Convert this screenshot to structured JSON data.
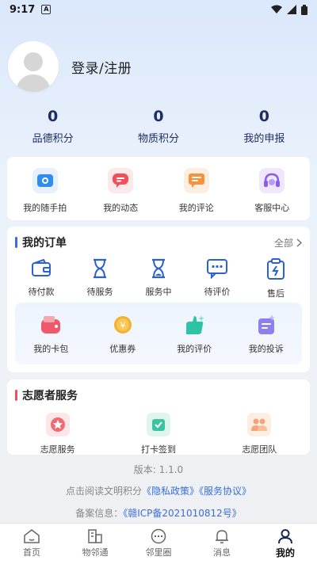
{
  "status_bar": {
    "time": "9:17",
    "badge": "A"
  },
  "profile": {
    "login_label": "登录/注册"
  },
  "stats": [
    {
      "value": "0",
      "label": "品德积分"
    },
    {
      "value": "0",
      "label": "物质积分"
    },
    {
      "value": "0",
      "label": "我的申报"
    }
  ],
  "quick_actions": [
    {
      "label": "我的随手拍",
      "icon": "camera-icon",
      "color": "#2f8cf0"
    },
    {
      "label": "我的动态",
      "icon": "chat-bubble-icon",
      "color": "#f0505a"
    },
    {
      "label": "我的评论",
      "icon": "comment-icon",
      "color": "#f7913a"
    },
    {
      "label": "客服中心",
      "icon": "headset-icon",
      "color": "#8a5cf0"
    }
  ],
  "orders": {
    "title": "我的订单",
    "more_label": "全部",
    "accent": "#3a6ed8",
    "items": [
      {
        "label": "待付款",
        "icon": "wallet-icon"
      },
      {
        "label": "待服务",
        "icon": "hourglass-icon"
      },
      {
        "label": "服务中",
        "icon": "hourglass-half-icon"
      },
      {
        "label": "待评价",
        "icon": "comment-dots-icon"
      },
      {
        "label": "售后",
        "icon": "clipboard-icon"
      }
    ],
    "extras": [
      {
        "label": "我的卡包",
        "icon": "wallet-card-icon",
        "color": "#ef5a6b"
      },
      {
        "label": "优惠券",
        "icon": "coupon-icon",
        "color": "#f5b12b"
      },
      {
        "label": "我的评价",
        "icon": "evaluation-icon",
        "color": "#2fc3a6"
      },
      {
        "label": "我的投诉",
        "icon": "complaint-icon",
        "color": "#8d7ff0"
      }
    ]
  },
  "volunteer": {
    "title": "志愿者服务",
    "accent": "#f0505a",
    "items": [
      {
        "label": "志愿服务",
        "icon": "star-badge-icon",
        "color": "#f06a72"
      },
      {
        "label": "打卡签到",
        "icon": "check-in-icon",
        "color": "#3cc4a0"
      },
      {
        "label": "志愿团队",
        "icon": "team-icon",
        "color": "#f3a577"
      }
    ]
  },
  "footer": {
    "version": "版本: 1.1.0",
    "agree_prefix": "点击阅读文明积分",
    "privacy_link": "《隐私政策》",
    "service_link": "《服务协议》",
    "icp_prefix": "备案信息：",
    "icp_link": "《赣ICP备2021010812号》"
  },
  "tabbar": [
    {
      "label": "首页",
      "icon": "home-icon"
    },
    {
      "label": "物邻通",
      "icon": "building-icon"
    },
    {
      "label": "邻里圈",
      "icon": "circle-chat-icon"
    },
    {
      "label": "消息",
      "icon": "bell-icon"
    },
    {
      "label": "我的",
      "icon": "user-icon",
      "active": true
    }
  ]
}
